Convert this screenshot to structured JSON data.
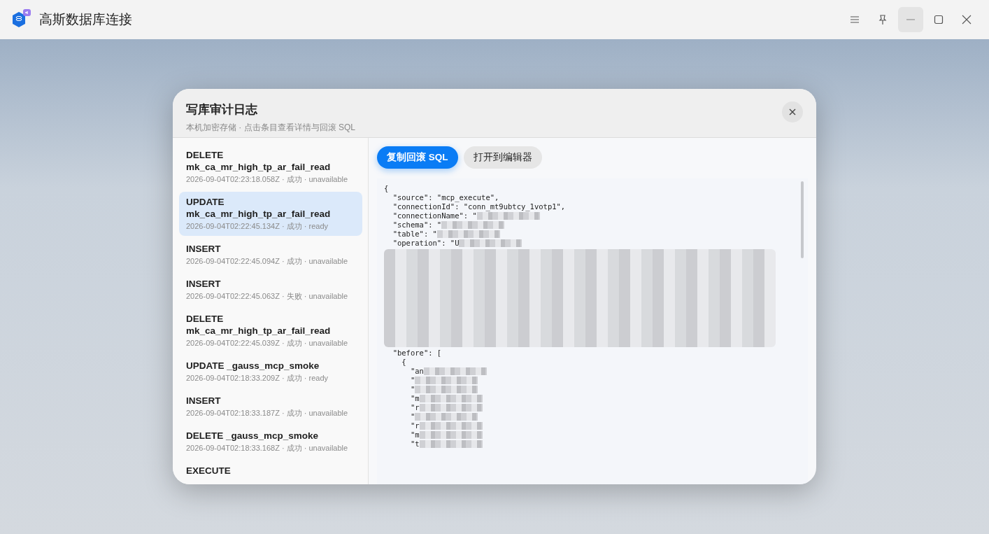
{
  "window": {
    "title": "高斯数据库连接"
  },
  "dialog": {
    "title": "写库审计日志",
    "subtitle": "本机加密存储 · 点击条目查看详情与回滚 SQL"
  },
  "entries": [
    {
      "title": "DELETE mk_ca_mr_high_tp_ar_fail_read",
      "meta": "2026-09-04T02:23:18.058Z · 成功 · unavailable",
      "selected": false
    },
    {
      "title": "UPDATE mk_ca_mr_high_tp_ar_fail_read",
      "meta": "2026-09-04T02:22:45.134Z · 成功 · ready",
      "selected": true
    },
    {
      "title": "INSERT",
      "meta": "2026-09-04T02:22:45.094Z · 成功 · unavailable",
      "selected": false
    },
    {
      "title": "INSERT",
      "meta": "2026-09-04T02:22:45.063Z · 失败 · unavailable",
      "selected": false
    },
    {
      "title": "DELETE mk_ca_mr_high_tp_ar_fail_read",
      "meta": "2026-09-04T02:22:45.039Z · 成功 · unavailable",
      "selected": false
    },
    {
      "title": "UPDATE _gauss_mcp_smoke",
      "meta": "2026-09-04T02:18:33.209Z · 成功 · ready",
      "selected": false
    },
    {
      "title": "INSERT",
      "meta": "2026-09-04T02:18:33.187Z · 成功 · unavailable",
      "selected": false
    },
    {
      "title": "DELETE _gauss_mcp_smoke",
      "meta": "2026-09-04T02:18:33.168Z · 成功 · unavailable",
      "selected": false
    },
    {
      "title": "EXECUTE",
      "selected": false
    }
  ],
  "actions": [
    {
      "label": "复制回滚 SQL",
      "kind": "primary"
    },
    {
      "label": "打开到编辑器",
      "kind": "secondary"
    }
  ],
  "code_lines": [
    {
      "kind": "text",
      "text": "{"
    },
    {
      "kind": "text",
      "text": "  \"source\": \"mcp_execute\","
    },
    {
      "kind": "text",
      "text": "  \"connectionId\": \"conn_mt9ubtcy_1votp1\","
    },
    {
      "kind": "partial",
      "text": "  \"connectionName\": \""
    },
    {
      "kind": "partial",
      "text": "  \"schema\": \""
    },
    {
      "kind": "partial",
      "text": "  \"table\": \""
    },
    {
      "kind": "partial",
      "text": "  \"operation\": \"U"
    },
    {
      "kind": "mask"
    },
    {
      "kind": "text",
      "text": "  \"before\": ["
    },
    {
      "kind": "text",
      "text": "    {"
    },
    {
      "kind": "partial",
      "text": "      \"an"
    },
    {
      "kind": "partial",
      "text": "      \""
    },
    {
      "kind": "partial",
      "text": "      \""
    },
    {
      "kind": "partial",
      "text": "      \"m"
    },
    {
      "kind": "partial",
      "text": "      \"r"
    },
    {
      "kind": "partial",
      "text": "      \""
    },
    {
      "kind": "partial",
      "text": "      \"r"
    },
    {
      "kind": "partial",
      "text": "      \"m"
    },
    {
      "kind": "partial",
      "text": "      \"t"
    }
  ]
}
